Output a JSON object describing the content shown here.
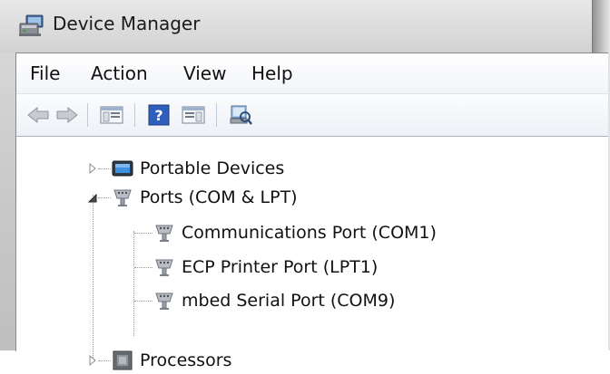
{
  "window": {
    "title": "Device Manager",
    "title_icon": "device-manager-icon"
  },
  "menu": {
    "items": [
      "File",
      "Action",
      "View",
      "Help"
    ]
  },
  "toolbar": {
    "buttons": [
      {
        "icon": "back-arrow-icon"
      },
      {
        "icon": "forward-arrow-icon"
      },
      {
        "icon": "show-hide-console-tree-icon"
      },
      {
        "icon": "help-icon"
      },
      {
        "icon": "show-hide-action-pane-icon"
      },
      {
        "icon": "scan-hardware-changes-icon"
      }
    ]
  },
  "tree": {
    "nodes": [
      {
        "label": "Portable Devices",
        "icon": "portable-devices-icon",
        "expander": "collapsed"
      },
      {
        "label": "Ports (COM & LPT)",
        "icon": "port-icon",
        "expander": "expanded"
      },
      {
        "label": "Communications Port (COM1)",
        "icon": "port-icon"
      },
      {
        "label": "ECP Printer Port (LPT1)",
        "icon": "port-icon"
      },
      {
        "label": "mbed Serial Port (COM9)",
        "icon": "port-icon"
      },
      {
        "label": "Processors",
        "icon": "processor-icon",
        "expander": "collapsed"
      }
    ]
  },
  "colors": {
    "window_frame": "#c9c9c9",
    "client_bg": "#ffffff",
    "toolbar_border": "#a9b3c2"
  }
}
